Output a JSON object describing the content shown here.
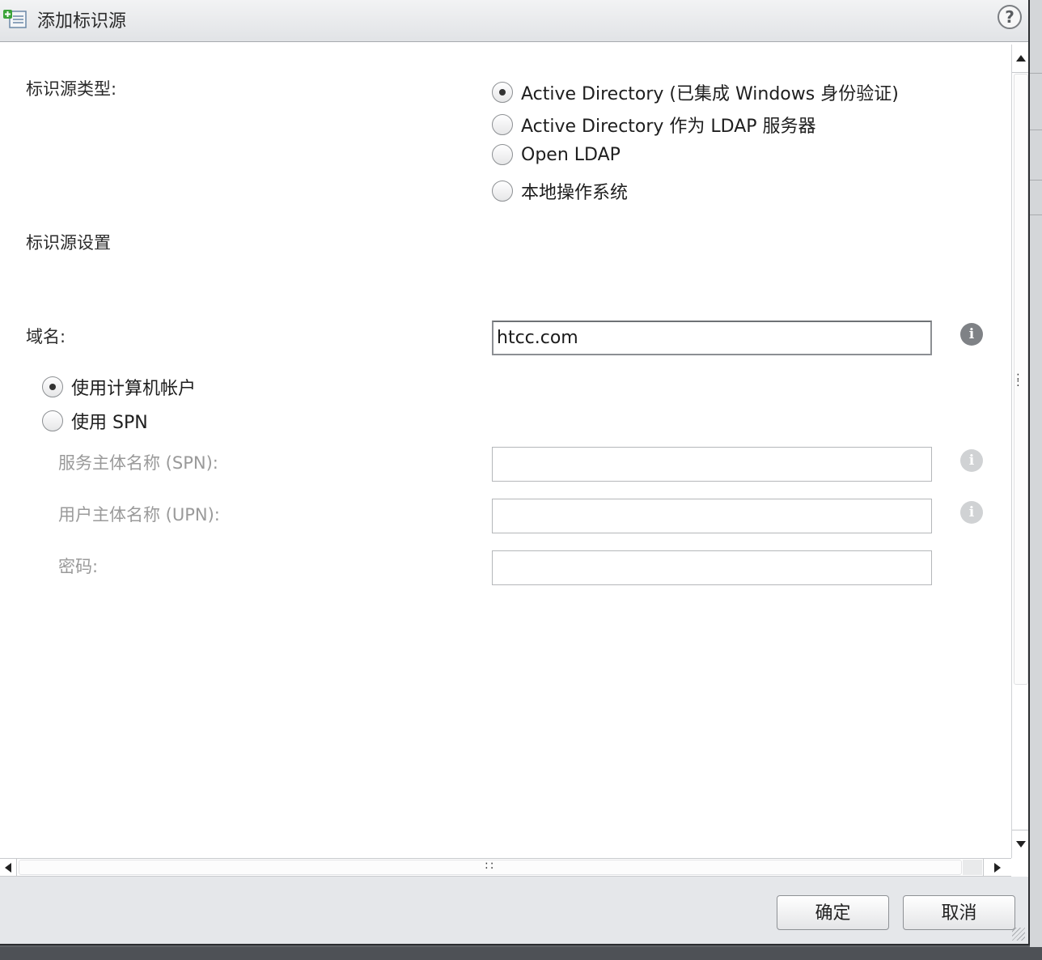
{
  "dialog": {
    "title": "添加标识源",
    "help_glyph": "?"
  },
  "form": {
    "source_type_label": "标识源类型:",
    "source_types": [
      {
        "label": "Active Directory (已集成 Windows 身份验证)",
        "selected": true
      },
      {
        "label": "Active Directory 作为 LDAP 服务器",
        "selected": false
      },
      {
        "label": "Open LDAP",
        "selected": false
      },
      {
        "label": "本地操作系统",
        "selected": false
      }
    ],
    "settings_heading": "标识源设置",
    "domain_label": "域名:",
    "domain_value": "htcc.com",
    "auth_options": [
      {
        "label": "使用计算机帐户",
        "selected": true
      },
      {
        "label": "使用 SPN",
        "selected": false
      }
    ],
    "spn_label": "服务主体名称 (SPN):",
    "spn_value": "",
    "upn_label": "用户主体名称 (UPN):",
    "upn_value": "",
    "password_label": "密码:",
    "password_value": "",
    "info_glyph": "i"
  },
  "footer": {
    "ok_label": "确定",
    "cancel_label": "取消"
  },
  "icons": {
    "title": "add-identity-source-icon",
    "help": "help-icon",
    "info": "info-icon"
  },
  "colors": {
    "titlebar": "#e6e8eb",
    "footer": "#e5e7ea",
    "disabled_text": "#9a9a9a",
    "info_icon": "#7f8286"
  }
}
